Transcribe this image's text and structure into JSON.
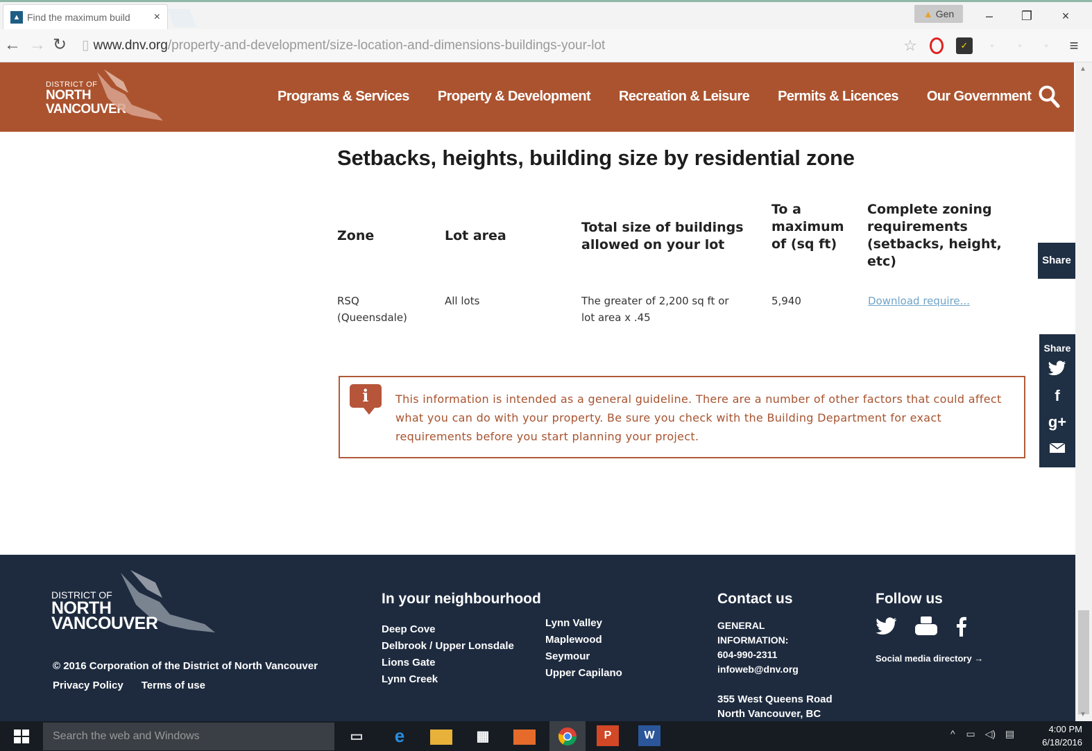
{
  "browser": {
    "tab_title": "Find the maximum build",
    "tab_close": "×",
    "profile_label": "Gen",
    "minimize": "–",
    "restore": "❐",
    "close": "×",
    "url_domain": "www.dnv.org",
    "url_path": "/property-and-development/size-location-and-dimensions-buildings-your-lot"
  },
  "header": {
    "logo_small": "DISTRICT OF",
    "logo_line1": "NORTH",
    "logo_line2": "VANCOUVER",
    "nav": [
      "Programs & Services",
      "Property & Development",
      "Recreation & Leisure",
      "Permits & Licences",
      "Our Government"
    ]
  },
  "main": {
    "title": "Setbacks, heights, building size by residential zone",
    "table": {
      "headers": {
        "zone": "Zone",
        "lot_area": "Lot area",
        "total_size": "Total size of buildings allowed on your lot",
        "max": "To a maximum of (sq ft)",
        "complete": "Complete zoning requirements (setbacks, height, etc)"
      },
      "rows": [
        {
          "zone": "RSQ (Queensdale)",
          "lot_area": "All lots",
          "total_size": "The greater of 2,200 sq ft or lot area x .45",
          "max": "5,940",
          "complete": "Download require..."
        }
      ]
    },
    "notice": "This information is intended as a general guideline. There are a number of other factors that could affect what you can do with your property. Be sure you check with the Building Department for exact requirements before you start planning your project.",
    "info_glyph": "i"
  },
  "share": {
    "label1": "Share",
    "label2": "Share",
    "facebook": "f",
    "gplus": "g+"
  },
  "footer": {
    "logo_small": "DISTRICT OF",
    "logo_line1": "NORTH",
    "logo_line2": "VANCOUVER",
    "copyright": "© 2016 Corporation of the District of North Vancouver",
    "privacy": "Privacy Policy",
    "terms": "Terms of use",
    "neighbourhood_heading": "In your neighbourhood",
    "neighbourhoods_col1": [
      "Deep Cove",
      "Delbrook / Upper Lonsdale",
      "Lions Gate",
      "Lynn Creek"
    ],
    "neighbourhoods_col2": [
      "Lynn Valley",
      "Maplewood",
      "Seymour",
      "Upper Capilano"
    ],
    "contact_heading": "Contact us",
    "contact_lines": [
      "GENERAL",
      "INFORMATION:",
      "604-990-2311",
      "infoweb@dnv.org"
    ],
    "address_lines": [
      "355 West Queens Road",
      "North Vancouver, BC"
    ],
    "follow_heading": "Follow us",
    "social_directory": "Social media directory →"
  },
  "taskbar": {
    "search_placeholder": "Search the web and Windows",
    "time": "4:00 PM",
    "date": "6/18/2016"
  }
}
